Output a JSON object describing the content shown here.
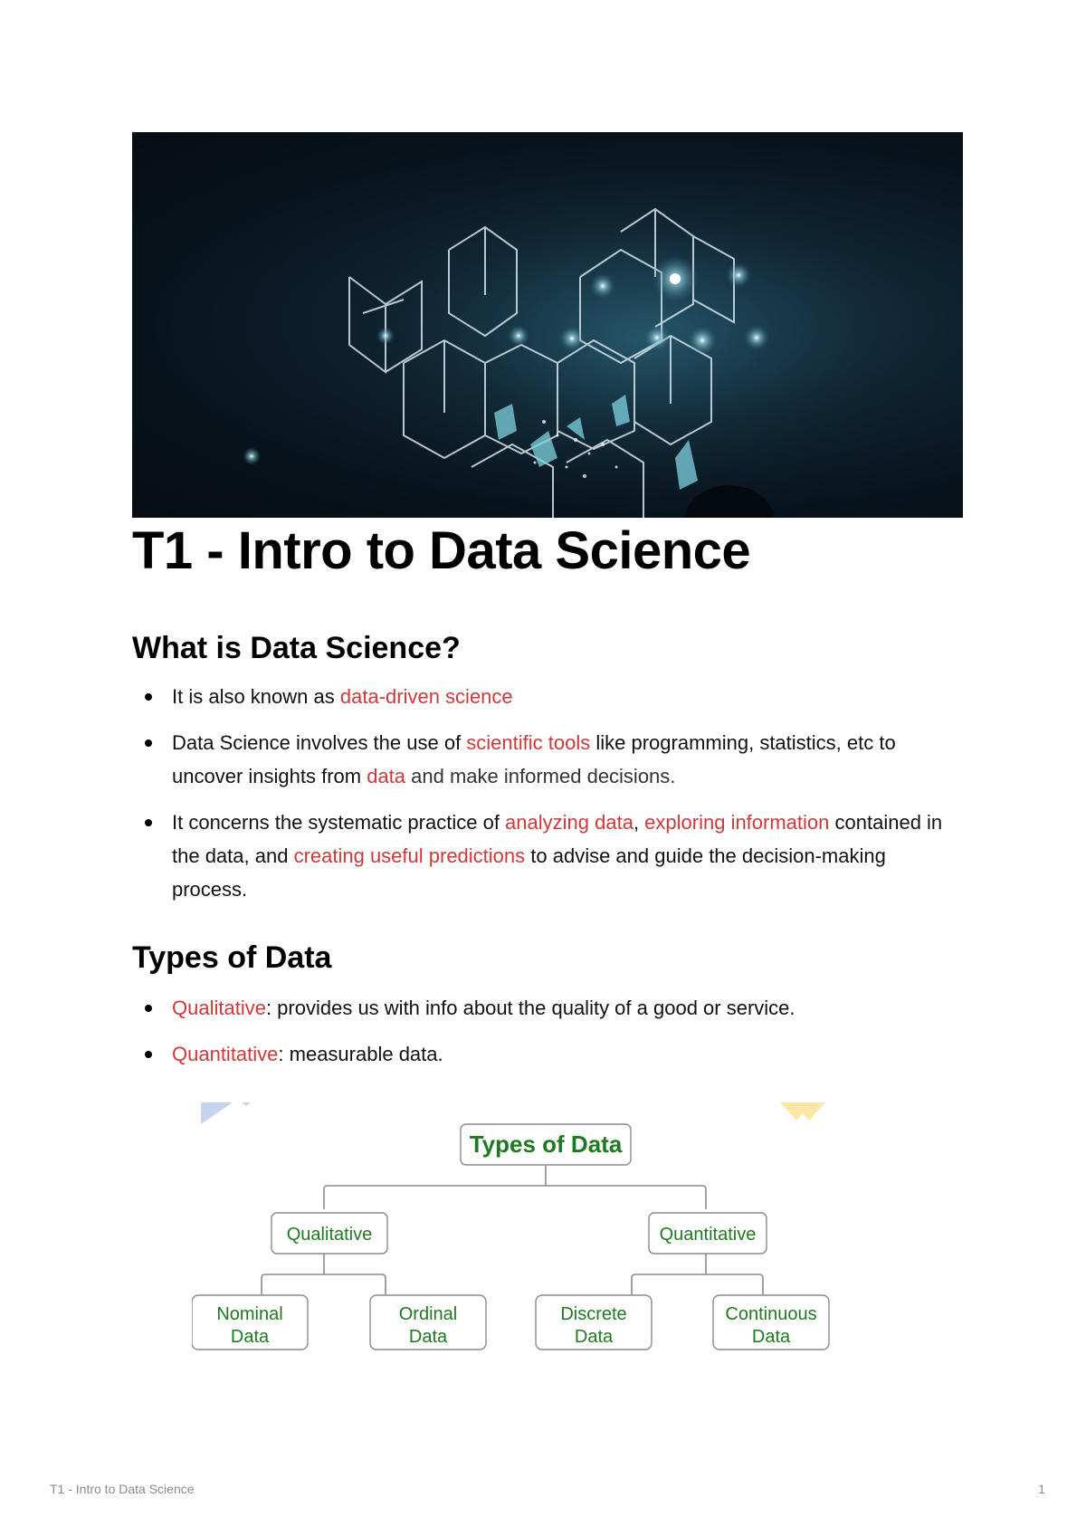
{
  "banner": {
    "description": "Dark stage with glowing wireframe cubes and light beams",
    "colors": {
      "background": "#08131c",
      "glow": "#5fb3c7",
      "line": "#d8e6ee"
    }
  },
  "title": "T1 - Intro to Data Science",
  "sections": {
    "what": {
      "heading": "What is Data Science?",
      "items": [
        {
          "parts": [
            {
              "t": "It is also known as ",
              "c": "n"
            },
            {
              "t": "data-driven science",
              "c": "r"
            }
          ]
        },
        {
          "parts": [
            {
              "t": "Data Science involves the use of ",
              "c": "n"
            },
            {
              "t": "scientific tools",
              "c": "r"
            },
            {
              "t": " like programming, statistics, etc to uncover insights from ",
              "c": "n"
            },
            {
              "t": "data",
              "c": "r"
            },
            {
              "t": " and make informed decisions.",
              "c": "g"
            }
          ]
        },
        {
          "parts": [
            {
              "t": "It concerns the systematic practice of ",
              "c": "n"
            },
            {
              "t": "analyzing data",
              "c": "r"
            },
            {
              "t": ", ",
              "c": "n"
            },
            {
              "t": "exploring information",
              "c": "r"
            },
            {
              "t": " contained in the data, and ",
              "c": "n"
            },
            {
              "t": "creating useful predictions",
              "c": "r"
            },
            {
              "t": " to advise and guide the decision-making process.",
              "c": "n"
            }
          ]
        }
      ]
    },
    "types": {
      "heading": "Types of Data",
      "items": [
        {
          "parts": [
            {
              "t": "Qualitative",
              "c": "r"
            },
            {
              "t": ": provides us with info about the quality of a good or service.",
              "c": "n"
            }
          ]
        },
        {
          "parts": [
            {
              "t": "Quantitative",
              "c": "r"
            },
            {
              "t": ": measurable data.",
              "c": "n"
            }
          ]
        }
      ]
    }
  },
  "diagram": {
    "root": "Types of Data",
    "level1": [
      "Qualitative",
      "Quantitative"
    ],
    "level2": [
      [
        "Nominal",
        "Data"
      ],
      [
        "Ordinal",
        "Data"
      ],
      [
        "Discrete",
        "Data"
      ],
      [
        "Continuous",
        "Data"
      ]
    ],
    "colors": {
      "text": "#1f7a1f",
      "border": "#8a8a8a"
    }
  },
  "footer": {
    "doc_title": "T1 - Intro to Data Science",
    "page_number": "1"
  },
  "accent_color": "#d0393a"
}
